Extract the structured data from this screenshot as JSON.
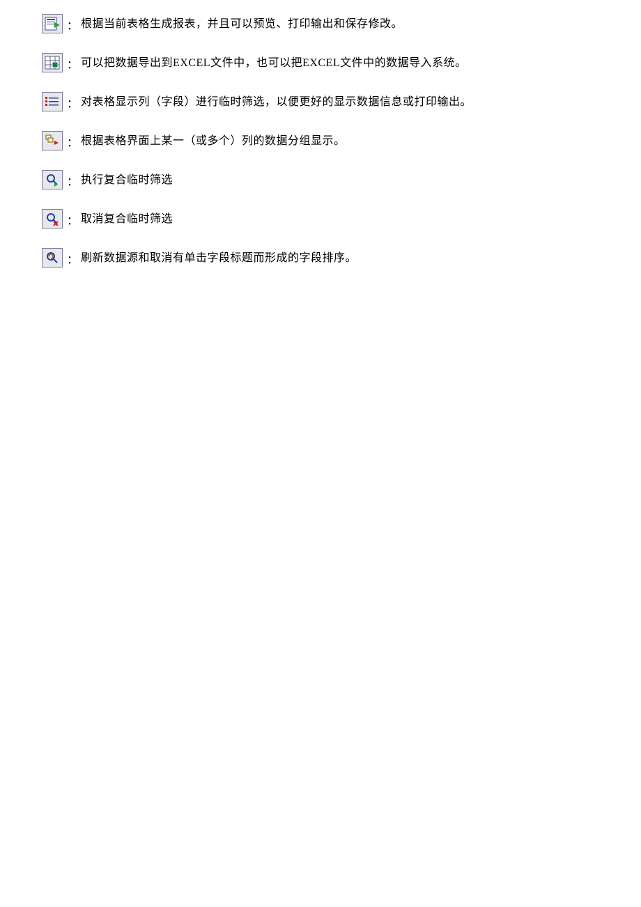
{
  "separator": "：",
  "items": [
    {
      "icon": "report-icon",
      "text": "根据当前表格生成报表，并且可以预览、打印输出和保存修改。"
    },
    {
      "icon": "excel-icon",
      "text": "可以把数据导出到EXCEL文件中，也可以把EXCEL文件中的数据导入系统。"
    },
    {
      "icon": "columns-icon",
      "text": "对表格显示列（字段）进行临时筛选，以便更好的显示数据信息或打印输出。"
    },
    {
      "icon": "group-icon",
      "text": "根据表格界面上某一（或多个）列的数据分组显示。"
    },
    {
      "icon": "filter-run-icon",
      "text": "执行复合临时筛选"
    },
    {
      "icon": "filter-cancel-icon",
      "text": "取消复合临时筛选"
    },
    {
      "icon": "refresh-icon",
      "text": "刷新数据源和取消有单击字段标题而形成的字段排序。"
    }
  ]
}
